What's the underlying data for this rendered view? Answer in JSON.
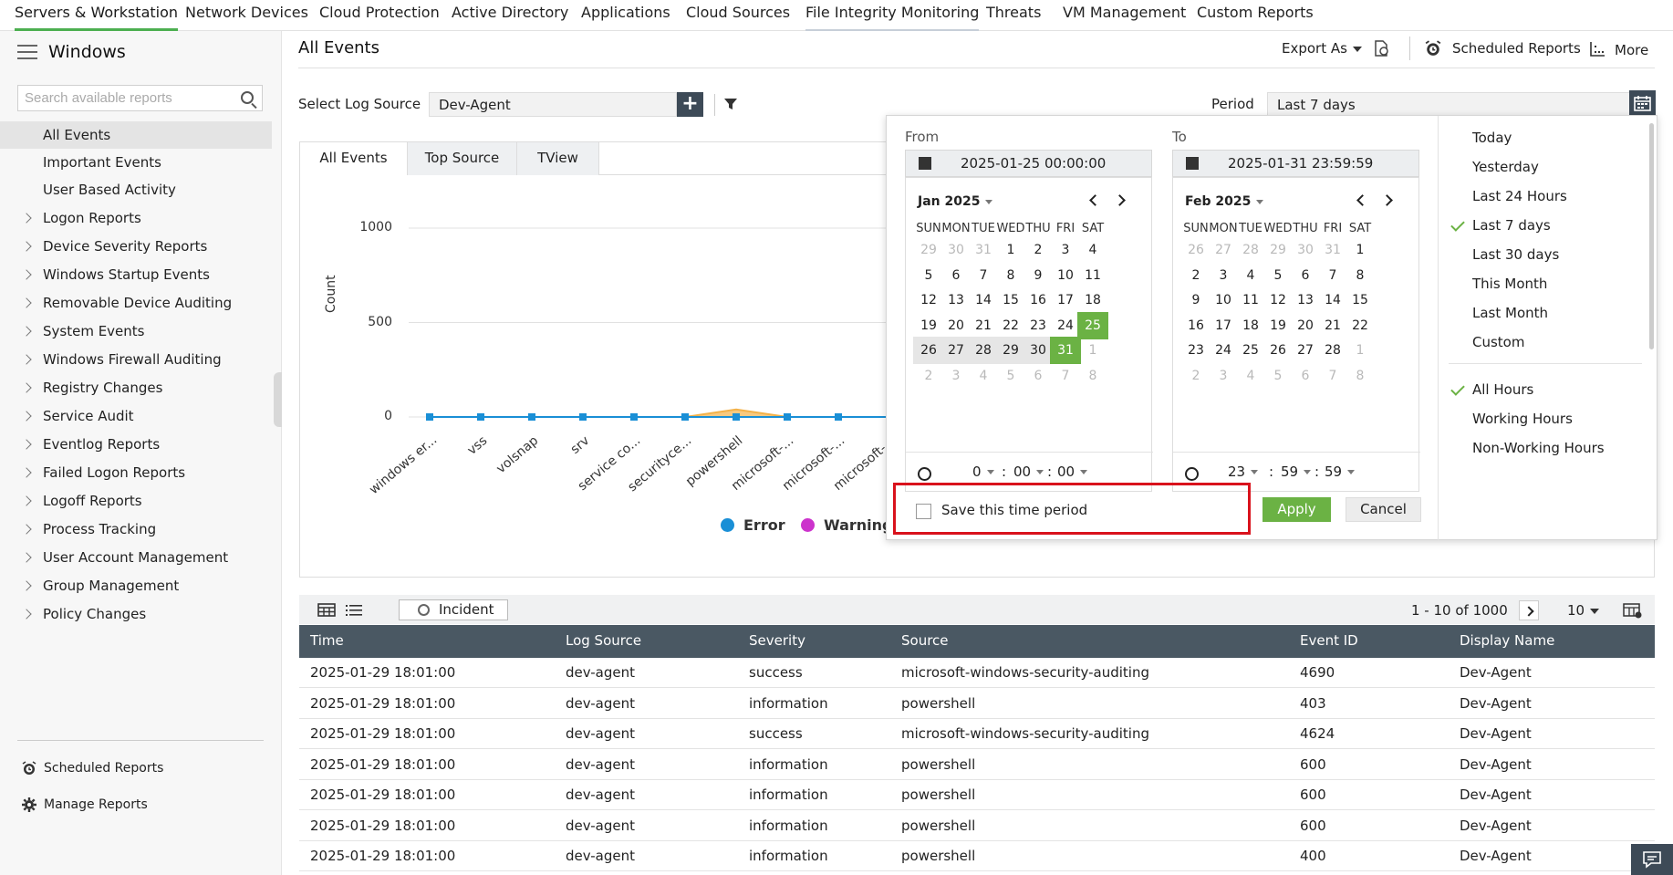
{
  "topnav": {
    "tabs": [
      "Servers & Workstation",
      "Network Devices",
      "Cloud Protection",
      "Active Directory",
      "Applications",
      "Cloud Sources",
      "File Integrity Monitoring",
      "Threats",
      "VM Management",
      "Custom Reports"
    ]
  },
  "sidebar": {
    "title": "Windows",
    "search_placeholder": "Search available reports",
    "items": [
      {
        "label": "All Events",
        "expandable": false,
        "selected": true
      },
      {
        "label": "Important Events",
        "expandable": false
      },
      {
        "label": "User Based Activity",
        "expandable": false
      },
      {
        "label": "Logon Reports",
        "expandable": true
      },
      {
        "label": "Device Severity Reports",
        "expandable": true
      },
      {
        "label": "Windows Startup Events",
        "expandable": true
      },
      {
        "label": "Removable Device Auditing",
        "expandable": true
      },
      {
        "label": "System Events",
        "expandable": true
      },
      {
        "label": "Windows Firewall Auditing",
        "expandable": true
      },
      {
        "label": "Registry Changes",
        "expandable": true
      },
      {
        "label": "Service Audit",
        "expandable": true
      },
      {
        "label": "Eventlog Reports",
        "expandable": true
      },
      {
        "label": "Failed Logon Reports",
        "expandable": true
      },
      {
        "label": "Logoff Reports",
        "expandable": true
      },
      {
        "label": "Process Tracking",
        "expandable": true
      },
      {
        "label": "User Account Management",
        "expandable": true
      },
      {
        "label": "Group Management",
        "expandable": true
      },
      {
        "label": "Policy Changes",
        "expandable": true
      }
    ],
    "footer": {
      "scheduled": "Scheduled Reports",
      "manage": "Manage Reports"
    }
  },
  "header": {
    "title": "All Events",
    "export_as": "Export As",
    "scheduled_reports": "Scheduled Reports",
    "more": "More"
  },
  "filters": {
    "log_source_label": "Select Log Source",
    "log_source_value": "Dev-Agent",
    "period_label": "Period",
    "period_value": "Last 7 days"
  },
  "chart_tabs": [
    "All Events",
    "Top Source",
    "TView"
  ],
  "chart_data": {
    "type": "area",
    "ylabel": "Count",
    "yticks": [
      "1000",
      "500",
      "0"
    ],
    "ylim": [
      0,
      1000
    ],
    "categories": [
      "windows er...",
      "vss",
      "volsnap",
      "srv",
      "service co...",
      "securityce...",
      "powershell",
      "microsoft-...",
      "microsoft-...",
      "microsoft-..."
    ],
    "series": [
      {
        "name": "Error",
        "color": "#1a8fd6",
        "values": [
          0,
          0,
          0,
          0,
          0,
          0,
          0,
          0,
          0,
          0
        ]
      },
      {
        "name": "Warning",
        "color": "#cc33cc",
        "values": [
          0,
          0,
          0,
          0,
          0,
          0,
          0,
          0,
          0,
          0
        ]
      },
      {
        "color": "#f3b24a",
        "values": [
          0,
          0,
          0,
          0,
          0,
          0,
          40,
          0,
          0,
          0
        ]
      }
    ],
    "legend_position": "bottom"
  },
  "datepicker": {
    "from_label": "From",
    "to_label": "To",
    "from_value": "2025-01-25 00:00:00",
    "to_value": "2025-01-31 23:59:59",
    "left_month": "Jan 2025",
    "right_month": "Feb 2025",
    "dow": [
      "SUN",
      "MON",
      "TUE",
      "WED",
      "THU",
      "FRI",
      "SAT"
    ],
    "left_days": [
      [
        "29",
        "30",
        "31",
        "1",
        "2",
        "3",
        "4"
      ],
      [
        "5",
        "6",
        "7",
        "8",
        "9",
        "10",
        "11"
      ],
      [
        "12",
        "13",
        "14",
        "15",
        "16",
        "17",
        "18"
      ],
      [
        "19",
        "20",
        "21",
        "22",
        "23",
        "24",
        "25"
      ],
      [
        "26",
        "27",
        "28",
        "29",
        "30",
        "31",
        "1"
      ],
      [
        "2",
        "3",
        "4",
        "5",
        "6",
        "7",
        "8"
      ]
    ],
    "right_days": [
      [
        "26",
        "27",
        "28",
        "29",
        "30",
        "31",
        "1"
      ],
      [
        "2",
        "3",
        "4",
        "5",
        "6",
        "7",
        "8"
      ],
      [
        "9",
        "10",
        "11",
        "12",
        "13",
        "14",
        "15"
      ],
      [
        "16",
        "17",
        "18",
        "19",
        "20",
        "21",
        "22"
      ],
      [
        "23",
        "24",
        "25",
        "26",
        "27",
        "28",
        "1"
      ],
      [
        "2",
        "3",
        "4",
        "5",
        "6",
        "7",
        "8"
      ]
    ],
    "from_time": {
      "h": "0",
      "m": "00",
      "s": "00"
    },
    "to_time": {
      "h": "23",
      "m": "59",
      "s": "59"
    },
    "save_label": "Save this time period",
    "apply": "Apply",
    "cancel": "Cancel",
    "presets": [
      "Today",
      "Yesterday",
      "Last 24 Hours",
      "Last 7 days",
      "Last 30 days",
      "This Month",
      "Last Month",
      "Custom"
    ],
    "selected_preset": "Last 7 days",
    "hour_filters": [
      "All Hours",
      "Working Hours",
      "Non-Working Hours"
    ],
    "selected_hour_filter": "All Hours"
  },
  "table": {
    "incident_label": "Incident",
    "pager": "1 - 10 of 1000",
    "page_size": "10",
    "columns": [
      "Time",
      "Log Source",
      "Severity",
      "Source",
      "Event ID",
      "Display Name"
    ],
    "rows": [
      [
        "2025-01-29 18:01:00",
        "dev-agent",
        "success",
        "microsoft-windows-security-auditing",
        "4690",
        "Dev-Agent"
      ],
      [
        "2025-01-29 18:01:00",
        "dev-agent",
        "information",
        "powershell",
        "403",
        "Dev-Agent"
      ],
      [
        "2025-01-29 18:01:00",
        "dev-agent",
        "success",
        "microsoft-windows-security-auditing",
        "4624",
        "Dev-Agent"
      ],
      [
        "2025-01-29 18:01:00",
        "dev-agent",
        "information",
        "powershell",
        "600",
        "Dev-Agent"
      ],
      [
        "2025-01-29 18:01:00",
        "dev-agent",
        "information",
        "powershell",
        "600",
        "Dev-Agent"
      ],
      [
        "2025-01-29 18:01:00",
        "dev-agent",
        "information",
        "powershell",
        "600",
        "Dev-Agent"
      ],
      [
        "2025-01-29 18:01:00",
        "dev-agent",
        "information",
        "powershell",
        "400",
        "Dev-Agent"
      ]
    ]
  }
}
